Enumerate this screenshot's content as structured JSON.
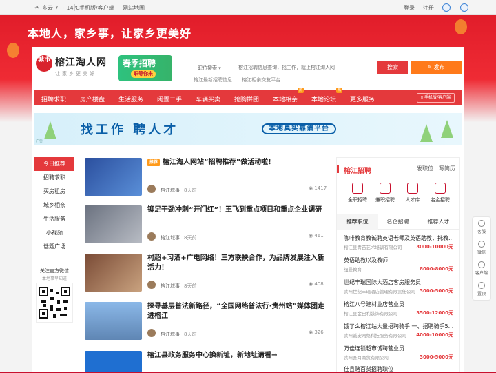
{
  "topbar": {
    "weather": "多云 7 ~ 14℃",
    "mobile": "手机版/客户端",
    "sitemap": "网站地图",
    "login": "登录",
    "register": "注册"
  },
  "slogan": "本地人，家乡事，让家乡更美好",
  "logo": {
    "badge": "城市",
    "name": "榕江淘人网",
    "tagline": "让家乡更美好"
  },
  "promo": {
    "title": "春季招聘",
    "sub": "职等你来"
  },
  "search": {
    "category": "职位搜索",
    "placeholder": "榕江招聘信息查询，找工作，就上榕江淘人网",
    "button": "搜索",
    "post": "发布",
    "hot": [
      "榕江最新招聘信息",
      "榕江相亲交友平台"
    ]
  },
  "nav": {
    "items": [
      "招聘求职",
      "房产楼盘",
      "生活服务",
      "闲置二手",
      "车辆买卖",
      "抢购拼团",
      "本地相亲",
      "本地论坛",
      "更多服务"
    ],
    "badges": [
      "热",
      "热"
    ],
    "mobile": "手机版/客户端"
  },
  "ad": {
    "main": "找工作 聘人才",
    "pill": "本地真实靠谱平台",
    "tag": "广告"
  },
  "sidebar": {
    "items": [
      "今日推荐",
      "招聘求职",
      "买房租房",
      "城乡相亲",
      "生活服务",
      "小视频",
      "话题广场"
    ],
    "follow": "关注官方微信",
    "follow_sub": "本地事早知道"
  },
  "news": [
    {
      "tag": "推荐",
      "title": "榕江淘人网站“招聘推荐”做活动啦！",
      "author": "榕江城事",
      "time": "8天前",
      "views": "1417"
    },
    {
      "title": "铆足干劲冲刺“开门红”！王飞到重点项目和重点企业调研",
      "author": "榕江城事",
      "time": "8天前",
      "views": "461"
    },
    {
      "title": "村超+习酒+广电网络！三方联袂合作，为品牌发展注入新活力！",
      "author": "榕江城事",
      "time": "8天前",
      "views": "408"
    },
    {
      "title": "探寻基层普法新路径，“全国网络普法行·贵州站”媒体团走进榕江",
      "author": "榕江城事",
      "time": "8天前",
      "views": "326"
    },
    {
      "title": "榕江县政务服务中心换新址，新地址请看→",
      "author": "",
      "time": "",
      "views": ""
    }
  ],
  "jobs_panel": {
    "title": "榕江招聘",
    "links": [
      "发职位",
      "写简历"
    ],
    "cats": [
      "全职招聘",
      "兼职招聘",
      "人才库",
      "名企招聘"
    ],
    "tabs": [
      "推荐职位",
      "名企招聘",
      "推荐人才"
    ],
    "jobs": [
      {
        "title": "咖啡教育教诚聘英语老师及英语助教，托教...",
        "company": "榕江县青苗艺术培训有限公司",
        "salary": "3000-10000元"
      },
      {
        "title": "英语助教以及教师",
        "company": "纽曼教育",
        "salary": "8000-8000元"
      },
      {
        "title": "世纪丰瑞国际大酒店客房服务员",
        "company": "贵州世纪丰瑞酒店管理有限责任公司",
        "salary": "3000-5000元"
      },
      {
        "title": "榕江八号建材业店营业员",
        "company": "榕江县金巴利装饰有限公司",
        "salary": "3500-12000元"
      },
      {
        "title": "饿了么榕江站大量招聘骑手 一、招聘骑手5...",
        "company": "贵州诚安网络科技服务有限公司",
        "salary": "4000-10000元"
      },
      {
        "title": "万佳连锁超市诚聘营业员",
        "company": "贵州吾月商贸有限公司",
        "salary": "3000-5000元"
      },
      {
        "title": "佳县赌百货招聘职位",
        "company": "",
        "salary": ""
      }
    ]
  },
  "rightbar": [
    "客服",
    "微信",
    "客户端",
    "置顶"
  ]
}
